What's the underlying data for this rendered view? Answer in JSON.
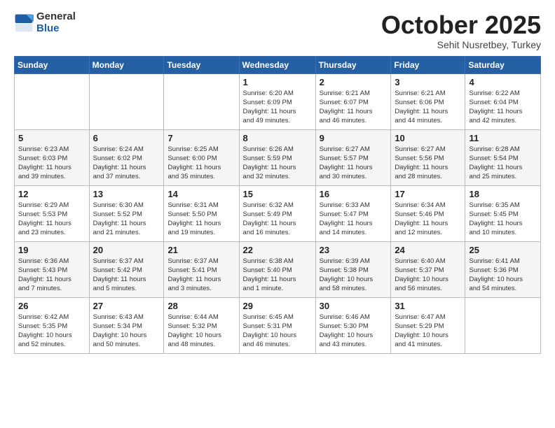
{
  "logo": {
    "general": "General",
    "blue": "Blue"
  },
  "title": "October 2025",
  "subtitle": "Sehit Nusretbey, Turkey",
  "days_of_week": [
    "Sunday",
    "Monday",
    "Tuesday",
    "Wednesday",
    "Thursday",
    "Friday",
    "Saturday"
  ],
  "weeks": [
    [
      {
        "day": "",
        "info": ""
      },
      {
        "day": "",
        "info": ""
      },
      {
        "day": "",
        "info": ""
      },
      {
        "day": "1",
        "info": "Sunrise: 6:20 AM\nSunset: 6:09 PM\nDaylight: 11 hours\nand 49 minutes."
      },
      {
        "day": "2",
        "info": "Sunrise: 6:21 AM\nSunset: 6:07 PM\nDaylight: 11 hours\nand 46 minutes."
      },
      {
        "day": "3",
        "info": "Sunrise: 6:21 AM\nSunset: 6:06 PM\nDaylight: 11 hours\nand 44 minutes."
      },
      {
        "day": "4",
        "info": "Sunrise: 6:22 AM\nSunset: 6:04 PM\nDaylight: 11 hours\nand 42 minutes."
      }
    ],
    [
      {
        "day": "5",
        "info": "Sunrise: 6:23 AM\nSunset: 6:03 PM\nDaylight: 11 hours\nand 39 minutes."
      },
      {
        "day": "6",
        "info": "Sunrise: 6:24 AM\nSunset: 6:02 PM\nDaylight: 11 hours\nand 37 minutes."
      },
      {
        "day": "7",
        "info": "Sunrise: 6:25 AM\nSunset: 6:00 PM\nDaylight: 11 hours\nand 35 minutes."
      },
      {
        "day": "8",
        "info": "Sunrise: 6:26 AM\nSunset: 5:59 PM\nDaylight: 11 hours\nand 32 minutes."
      },
      {
        "day": "9",
        "info": "Sunrise: 6:27 AM\nSunset: 5:57 PM\nDaylight: 11 hours\nand 30 minutes."
      },
      {
        "day": "10",
        "info": "Sunrise: 6:27 AM\nSunset: 5:56 PM\nDaylight: 11 hours\nand 28 minutes."
      },
      {
        "day": "11",
        "info": "Sunrise: 6:28 AM\nSunset: 5:54 PM\nDaylight: 11 hours\nand 25 minutes."
      }
    ],
    [
      {
        "day": "12",
        "info": "Sunrise: 6:29 AM\nSunset: 5:53 PM\nDaylight: 11 hours\nand 23 minutes."
      },
      {
        "day": "13",
        "info": "Sunrise: 6:30 AM\nSunset: 5:52 PM\nDaylight: 11 hours\nand 21 minutes."
      },
      {
        "day": "14",
        "info": "Sunrise: 6:31 AM\nSunset: 5:50 PM\nDaylight: 11 hours\nand 19 minutes."
      },
      {
        "day": "15",
        "info": "Sunrise: 6:32 AM\nSunset: 5:49 PM\nDaylight: 11 hours\nand 16 minutes."
      },
      {
        "day": "16",
        "info": "Sunrise: 6:33 AM\nSunset: 5:47 PM\nDaylight: 11 hours\nand 14 minutes."
      },
      {
        "day": "17",
        "info": "Sunrise: 6:34 AM\nSunset: 5:46 PM\nDaylight: 11 hours\nand 12 minutes."
      },
      {
        "day": "18",
        "info": "Sunrise: 6:35 AM\nSunset: 5:45 PM\nDaylight: 11 hours\nand 10 minutes."
      }
    ],
    [
      {
        "day": "19",
        "info": "Sunrise: 6:36 AM\nSunset: 5:43 PM\nDaylight: 11 hours\nand 7 minutes."
      },
      {
        "day": "20",
        "info": "Sunrise: 6:37 AM\nSunset: 5:42 PM\nDaylight: 11 hours\nand 5 minutes."
      },
      {
        "day": "21",
        "info": "Sunrise: 6:37 AM\nSunset: 5:41 PM\nDaylight: 11 hours\nand 3 minutes."
      },
      {
        "day": "22",
        "info": "Sunrise: 6:38 AM\nSunset: 5:40 PM\nDaylight: 11 hours\nand 1 minute."
      },
      {
        "day": "23",
        "info": "Sunrise: 6:39 AM\nSunset: 5:38 PM\nDaylight: 10 hours\nand 58 minutes."
      },
      {
        "day": "24",
        "info": "Sunrise: 6:40 AM\nSunset: 5:37 PM\nDaylight: 10 hours\nand 56 minutes."
      },
      {
        "day": "25",
        "info": "Sunrise: 6:41 AM\nSunset: 5:36 PM\nDaylight: 10 hours\nand 54 minutes."
      }
    ],
    [
      {
        "day": "26",
        "info": "Sunrise: 6:42 AM\nSunset: 5:35 PM\nDaylight: 10 hours\nand 52 minutes."
      },
      {
        "day": "27",
        "info": "Sunrise: 6:43 AM\nSunset: 5:34 PM\nDaylight: 10 hours\nand 50 minutes."
      },
      {
        "day": "28",
        "info": "Sunrise: 6:44 AM\nSunset: 5:32 PM\nDaylight: 10 hours\nand 48 minutes."
      },
      {
        "day": "29",
        "info": "Sunrise: 6:45 AM\nSunset: 5:31 PM\nDaylight: 10 hours\nand 46 minutes."
      },
      {
        "day": "30",
        "info": "Sunrise: 6:46 AM\nSunset: 5:30 PM\nDaylight: 10 hours\nand 43 minutes."
      },
      {
        "day": "31",
        "info": "Sunrise: 6:47 AM\nSunset: 5:29 PM\nDaylight: 10 hours\nand 41 minutes."
      },
      {
        "day": "",
        "info": ""
      }
    ]
  ]
}
